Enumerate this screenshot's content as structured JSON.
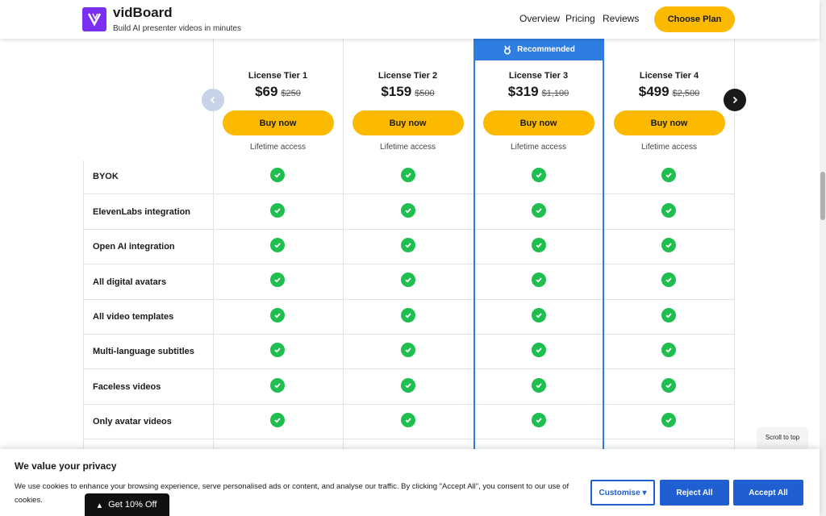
{
  "header": {
    "brand": "vidBoard",
    "tagline": "Build AI presenter videos in minutes",
    "nav": [
      "Overview",
      "Pricing",
      "Reviews"
    ],
    "cta": "Choose Plan"
  },
  "pricing": {
    "recommended_label": "Recommended",
    "tiers": [
      {
        "name": "License Tier 1",
        "price": "$69",
        "old_price": "$250",
        "button": "Buy now",
        "access": "Lifetime access"
      },
      {
        "name": "License Tier 2",
        "price": "$159",
        "old_price": "$500",
        "button": "Buy now",
        "access": "Lifetime access"
      },
      {
        "name": "License Tier 3",
        "price": "$319",
        "old_price": "$1,100",
        "button": "Buy now",
        "access": "Lifetime access"
      },
      {
        "name": "License Tier 4",
        "price": "$499",
        "old_price": "$2,500",
        "button": "Buy now",
        "access": "Lifetime access"
      }
    ],
    "features": [
      "BYOK",
      "ElevenLabs integration",
      "Open AI integration",
      "All digital avatars",
      "All video templates",
      "Multi-language subtitles",
      "Faceless videos",
      "Only avatar videos"
    ]
  },
  "scroll_top": "Scroll to top",
  "cookie": {
    "title": "We value your privacy",
    "text": "We use cookies to enhance your browsing experience, serve personalised ads or content, and analyse our traffic. By clicking \"Accept All\", you consent to our use of cookies.",
    "customise": "Customise",
    "reject": "Reject All",
    "accept": "Accept All"
  },
  "discount_tab": "Get 10% Off",
  "colors": {
    "accent_yellow": "#fbb900",
    "recommended_blue": "#2f7de1",
    "check_green": "#1ebe4f",
    "cookie_blue": "#1f5fd1",
    "brand_purple": "#7b2ff2"
  }
}
